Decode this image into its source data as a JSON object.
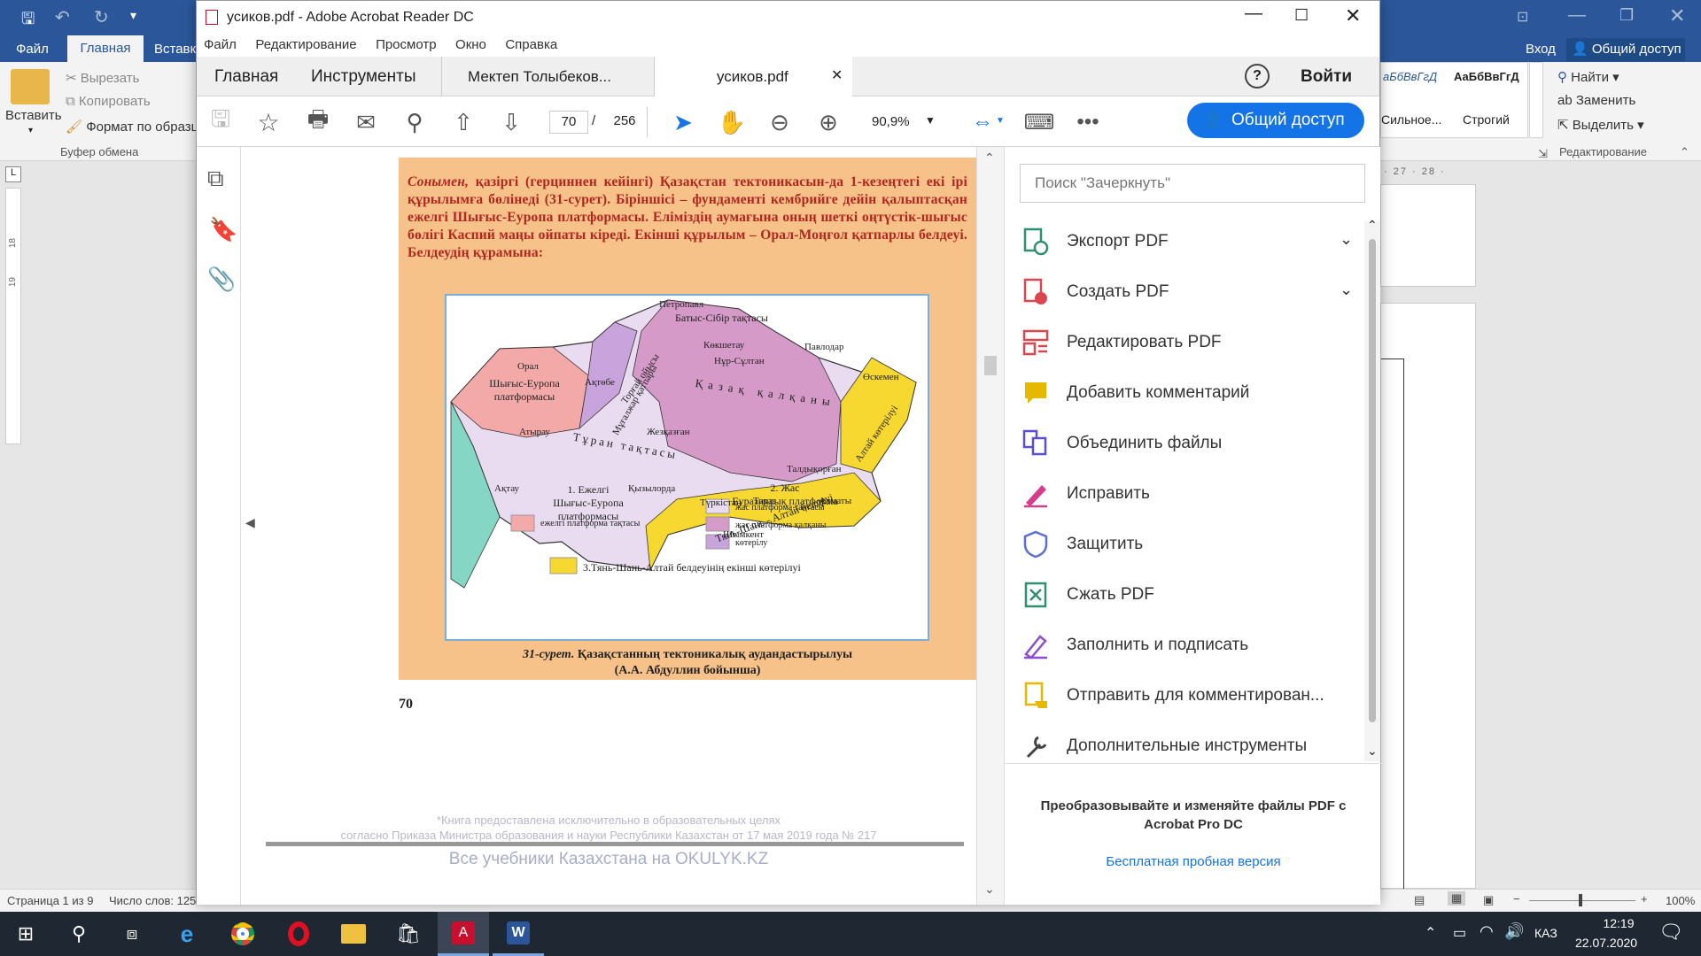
{
  "word": {
    "tabs": [
      "Файл",
      "Главная",
      "Вставка"
    ],
    "sign_in": "Вход",
    "share": "Общий доступ",
    "paste": "Вставить",
    "cut": "Вырезать",
    "copy": "Копировать",
    "format_painter": "Формат по образцу",
    "clipboard_group": "Буфер обмена",
    "styles": [
      {
        "preview": "аБбВвГгД",
        "name": "Сильное..."
      },
      {
        "preview": "АаБбВвГгД",
        "name": "Строгий"
      }
    ],
    "find": "Найти",
    "replace": "Заменить",
    "select": "Выделить",
    "editing_group": "Редактирование",
    "ruler": "· 27 · 28 ·",
    "status_page": "Страница 1 из 9",
    "status_words": "Число слов: 125",
    "zoom": "100%",
    "ruler_left": [
      "18",
      "19"
    ]
  },
  "acrobat": {
    "title": "усиков.pdf - Adobe Acrobat Reader DC",
    "menu": [
      "Файл",
      "Редактирование",
      "Просмотр",
      "Окно",
      "Справка"
    ],
    "tabs": {
      "home": "Главная",
      "tools": "Инструменты",
      "doc1": "Мектеп Толыбеков...",
      "doc2": "усиков.pdf"
    },
    "help": "?",
    "sign_in": "Войти",
    "page_current": "70",
    "page_sep": "/",
    "page_total": "256",
    "zoom": "90,9%",
    "share_button": "Общий доступ",
    "search_placeholder": "Поиск \"Зачеркнуть\"",
    "tools": [
      {
        "label": "Экспорт PDF",
        "color": "#2f8f6f",
        "icon": "export-pdf-icon"
      },
      {
        "label": "Создать PDF",
        "color": "#d9484f",
        "icon": "create-pdf-icon"
      },
      {
        "label": "Редактировать PDF",
        "color": "#d9484f",
        "icon": "edit-pdf-icon"
      },
      {
        "label": "Добавить комментарий",
        "color": "#e6b800",
        "icon": "comment-icon"
      },
      {
        "label": "Объединить файлы",
        "color": "#5a4fcf",
        "icon": "combine-icon"
      },
      {
        "label": "Исправить",
        "color": "#d63c8c",
        "icon": "fix-icon"
      },
      {
        "label": "Защитить",
        "color": "#5a6fcf",
        "icon": "protect-icon"
      },
      {
        "label": "Сжать PDF",
        "color": "#2f8f6f",
        "icon": "compress-icon"
      },
      {
        "label": "Заполнить и подписать",
        "color": "#8a4fcf",
        "icon": "sign-icon"
      },
      {
        "label": "Отправить для комментирован...",
        "color": "#e6b800",
        "icon": "send-comment-icon"
      },
      {
        "label": "Дополнительные инструменты",
        "color": "#444444",
        "icon": "more-tools-icon"
      }
    ],
    "promo": "Преобразовывайте и изменяйте файлы PDF с Acrobat Pro DC",
    "trial": "Бесплатная пробная версия"
  },
  "page": {
    "paragraph_lead": "Сонымен,",
    "paragraph": " қазіргі (герциннен кейінгі) Қазақстан тектоникасын-да 1-кезеңтегі екі ірі құрылымға бөлінеді (31-сурет). Біріншісі – фундаменті кембрийге дейін қалыптасқан ежелгі Шығыс-Еуропа платформасы. Еліміздің аумағына оның шеткі оңтүстік-шығыс бөлігі Каспий маңы ойпаты кіреді. Екінші құрылым – Орал-Моңғол қатпарлы белдеуі. Белдеудің құрамына:",
    "caption_fig": "31-сурет.",
    "caption_text": " Қазақстанның тектоникалық аудандастырылуы",
    "caption_author": "(А.А. Абдуллин бойынша)",
    "page_number": "70",
    "legend1_title": "1. Ежелгі\nШығыс-Еуропа\nплатформасы",
    "legend1_item": "ежелгі платформа тақтасы",
    "legend2_title": "2. Жас\nЕуразиялық платформа",
    "legend2_items": [
      "жас платформа тақтасы",
      "жас платформа қалқаны",
      "көтерілу"
    ],
    "legend3": "3.Тянь-Шань-Алтай белдеуінің екінші көтерілуі",
    "map_labels": [
      "Петропавл",
      "Батыс-Сібір тақтасы",
      "Көкшетау",
      "Павлодар",
      "Нұр-Сұлтан",
      "Орал",
      "Шығыс-Еуропа платформасы",
      "Ақтөбе",
      "Мұғалжар қатпары",
      "Торғай ойысы",
      "Қазақ қалқаны",
      "Өскемен",
      "Атырау",
      "Жезқазған",
      "Тұран тақтасы",
      "Ақтау",
      "Қызылорда",
      "Талдықорған",
      "Алматы",
      "Түркістан",
      "Тараз",
      "Шымкент",
      "Тянь-Шань - Алтай белдеуі",
      "Алтай көтерілуі"
    ],
    "footer_note1": "*Книга предоставлена исключительно в образовательных целях",
    "footer_note2": "согласно Приказа Министра образования и науки Республики Казахстан от 17 мая 2019 года № 217",
    "footer_site": "Все учебники Казахстана на OKULYK.KZ"
  },
  "taskbar": {
    "lang": "КАЗ",
    "time": "12:19",
    "date": "22.07.2020"
  }
}
